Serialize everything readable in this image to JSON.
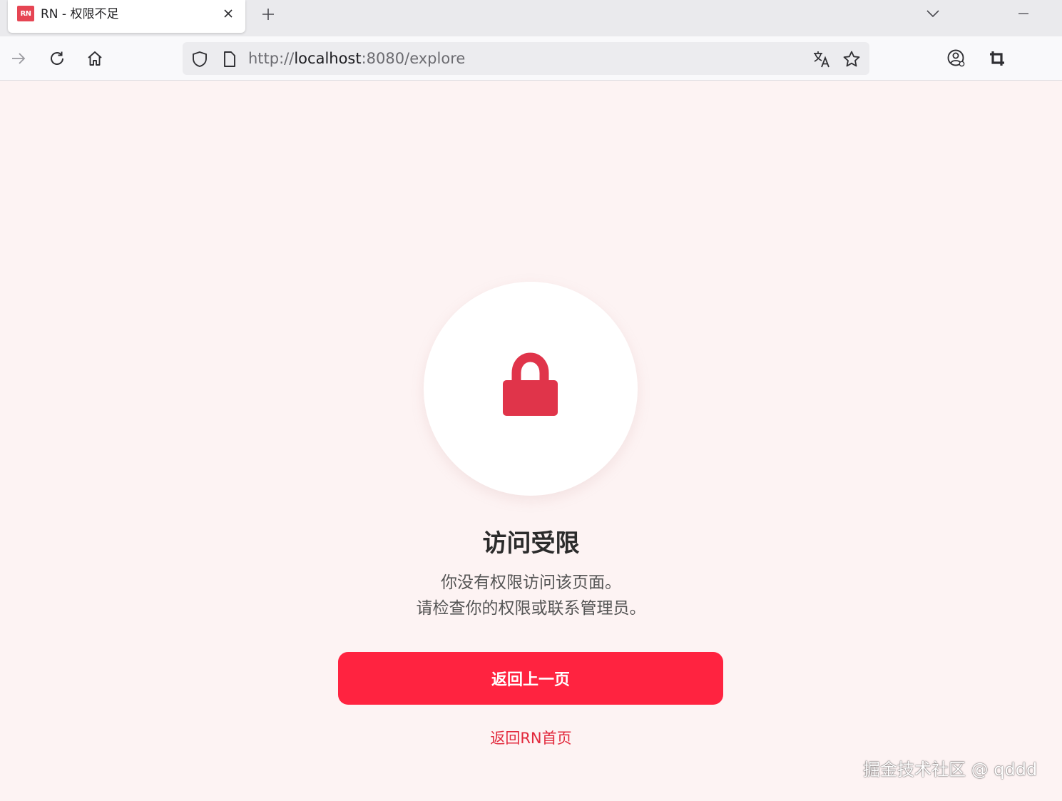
{
  "browser": {
    "tab": {
      "favicon_text": "RN",
      "title": "RN - 权限不足"
    },
    "url": {
      "scheme": "http://",
      "host": "localhost",
      "rest": ":8080/explore"
    }
  },
  "page": {
    "heading": "访问受限",
    "description_line1": "你没有权限访问该页面。",
    "description_line2": "请检查你的权限或联系管理员。",
    "back_button_label": "返回上一页",
    "home_link_label": "返回RN首页"
  },
  "watermark": "掘金技术社区 @ qddd",
  "colors": {
    "accent": "#ff2340",
    "lock": "#e0344a",
    "link": "#e2293c",
    "background": "#fdf3f3"
  },
  "icons": {
    "lock": "lock-icon",
    "forward": "arrow-right-icon",
    "reload": "reload-icon",
    "home": "home-icon",
    "shield": "shield-icon",
    "page": "page-icon",
    "translate": "translate-icon",
    "star": "star-icon",
    "account": "account-icon",
    "crop": "crop-icon"
  }
}
